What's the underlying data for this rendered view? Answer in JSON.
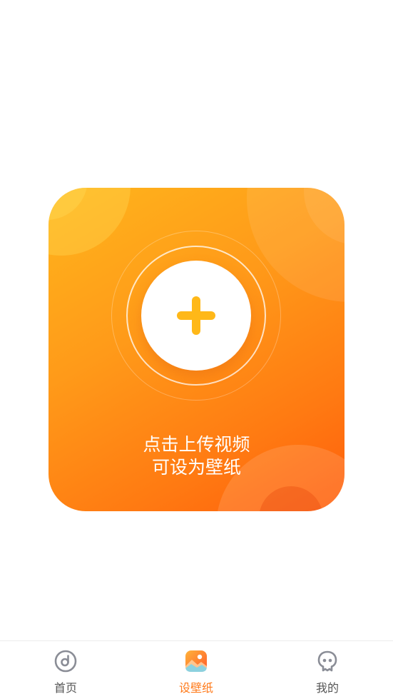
{
  "upload_card": {
    "line1": "点击上传视频",
    "line2": "可设为壁纸"
  },
  "tabs": [
    {
      "label": "首页",
      "icon": "music-disc-icon",
      "active": false
    },
    {
      "label": "设壁纸",
      "icon": "gallery-icon",
      "active": true
    },
    {
      "label": "我的",
      "icon": "profile-face-icon",
      "active": false
    }
  ],
  "colors": {
    "accent": "#ff7a1a",
    "card_gradient_start": "#ffb51c",
    "card_gradient_end": "#ff5e0c",
    "plus": "#ffb818",
    "tab_inactive": "#555555"
  }
}
